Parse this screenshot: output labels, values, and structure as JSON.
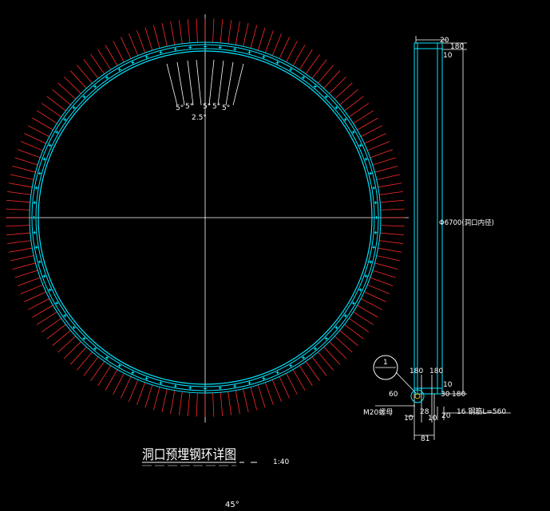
{
  "drawing": {
    "title": "洞口预埋钢环详图",
    "scale": "1:40",
    "bottom_note": "45°",
    "angle_labels": [
      "5°",
      "5°",
      "5°",
      "5°",
      "5°"
    ],
    "angle_total": "2.5°",
    "callout_number": "1"
  },
  "section": {
    "dims_top": [
      "20",
      "10",
      "180"
    ],
    "diameter_label": "Φ6700(洞口内径)",
    "dims_lower": [
      "180",
      "180",
      "10"
    ],
    "dims_bottom_right": [
      "30",
      "180"
    ],
    "dim_60": "60",
    "dim_28": "28",
    "dim_10_left": "10",
    "dim_10_mid": "10",
    "dim_20": "20",
    "dim_81": "81",
    "nut_label": "M20螺母",
    "rebar_label": "16 钢筋L=560"
  },
  "colors": {
    "background": "#000000",
    "ring": "#00e5ff",
    "rebar": "#ff2a2a",
    "lines": "#ffffff",
    "accent": "#ffff00"
  }
}
